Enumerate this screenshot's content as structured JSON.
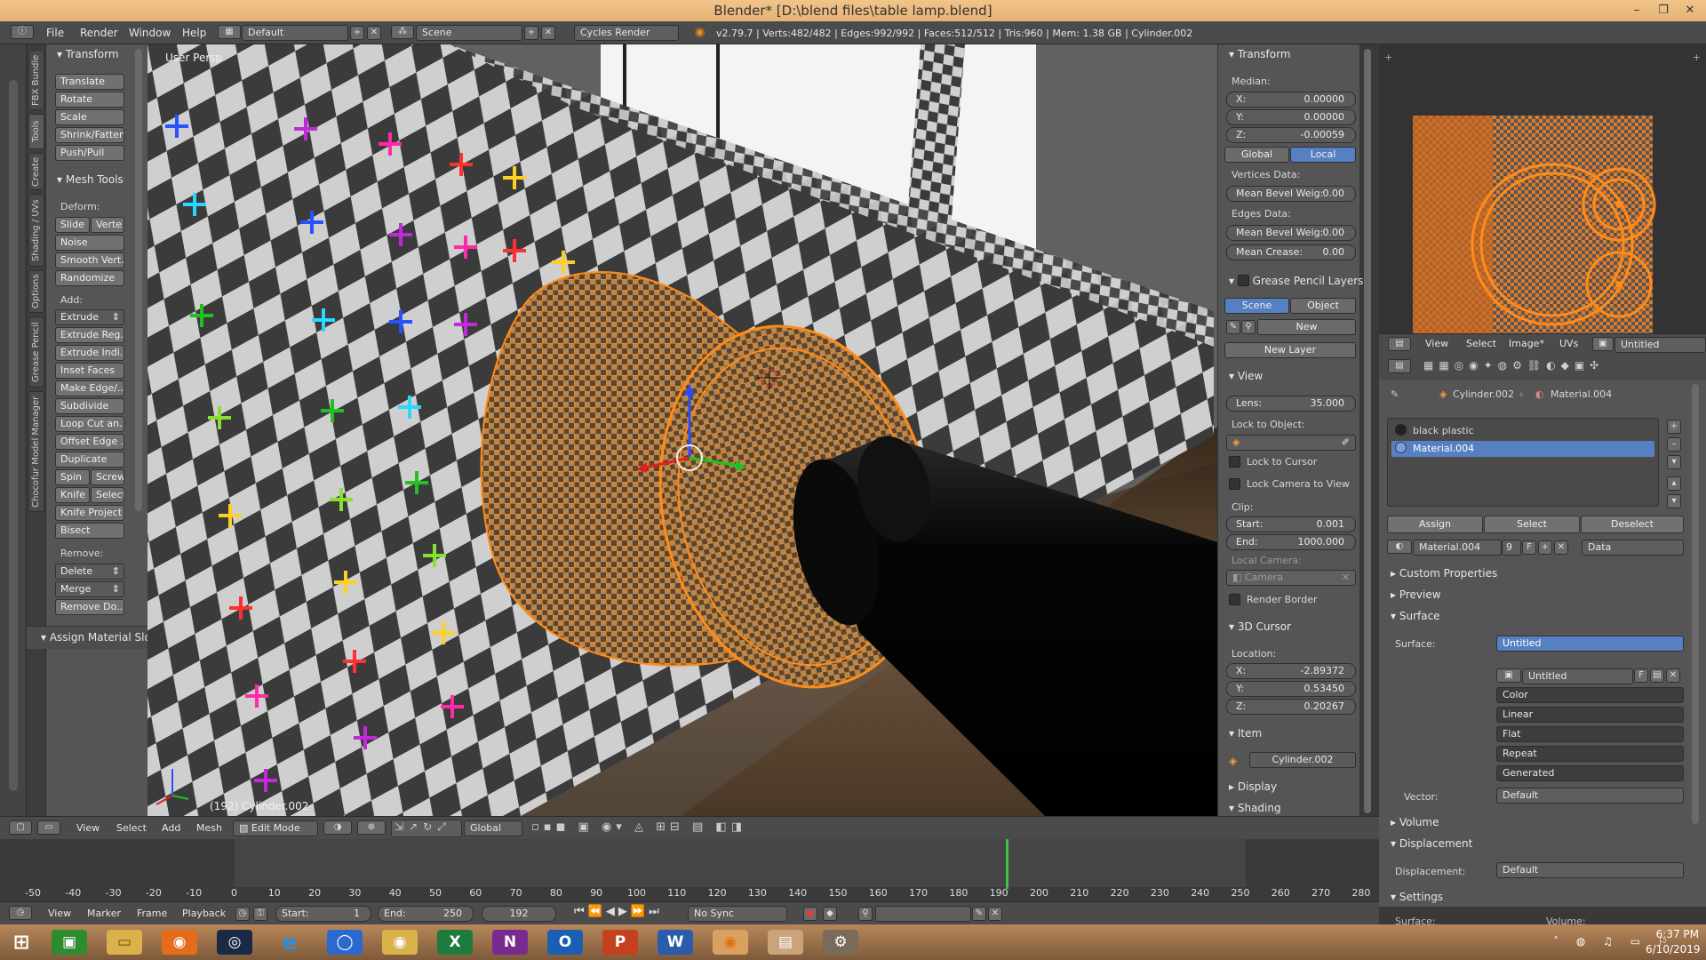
{
  "window": {
    "title": "Blender* [D:\\blend files\\table lamp.blend]",
    "controls": [
      "–",
      "❐",
      "✕"
    ]
  },
  "info_header": {
    "menus": [
      "File",
      "Render",
      "Window",
      "Help"
    ],
    "layout": "Default",
    "scene": "Scene",
    "engine": "Cycles Render",
    "stats": "v2.79.7 | Verts:482/482 | Edges:992/992 | Faces:512/512 | Tris:960 | Mem: 1.38 GB | Cylinder.002"
  },
  "tool_tabs": [
    "FBX Bundle",
    "Tools",
    "Create",
    "Shading / UVs",
    "Options",
    "Grease Pencil",
    "Chocofur Model Manager"
  ],
  "tool_shelf": {
    "transform": {
      "title": "Transform",
      "buttons": [
        "Translate",
        "Rotate",
        "Scale",
        "Shrink/Fatten",
        "Push/Pull"
      ]
    },
    "mesh_tools": {
      "title": "Mesh Tools",
      "deform_label": "Deform:",
      "slide": "Slide",
      "vertex": "Verte",
      "deform_buttons": [
        "Noise",
        "Smooth Vert.",
        "Randomize"
      ],
      "add_label": "Add:",
      "extrude": "Extrude",
      "add_buttons": [
        "Extrude Reg..",
        "Extrude Indi..",
        "Inset Faces",
        "Make Edge/..",
        "Subdivide",
        "Loop Cut an..",
        "Offset Edge ..",
        "Duplicate"
      ],
      "spin": "Spin",
      "screw": "Screw",
      "knife": "Knife",
      "select": "Select",
      "knife_project": "Knife Project",
      "bisect": "Bisect",
      "remove_label": "Remove:",
      "delete": "Delete",
      "merge": "Merge",
      "remove_doubles": "Remove Do.."
    },
    "assign_material": "Assign Material Slo"
  },
  "viewport": {
    "view_name": "User Persp",
    "object_label": "(192) Cylinder.002"
  },
  "n_panel": {
    "transform": "Transform",
    "median": "Median:",
    "x_label": "X:",
    "x": "0.00000",
    "y_label": "Y:",
    "y": "0.00000",
    "z_label": "Z:",
    "z": "-0.00059",
    "global": "Global",
    "local": "Local",
    "vertices_data": "Vertices Data:",
    "mean_bevel_v_label": "Mean Bevel Weig:",
    "mean_bevel_v": "0.00",
    "edges_data": "Edges Data:",
    "mean_bevel_e_label": "Mean Bevel Weig:",
    "mean_bevel_e": "0.00",
    "mean_crease_label": "Mean Crease:",
    "mean_crease": "0.00",
    "grease_pencil": "Grease Pencil Layers",
    "scene": "Scene",
    "object": "Object",
    "new": "New",
    "new_layer": "New Layer",
    "view": "View",
    "lens_label": "Lens:",
    "lens": "35.000",
    "lock_to_object": "Lock to Object:",
    "lock_to_cursor": "Lock to Cursor",
    "lock_camera": "Lock Camera to View",
    "clip": "Clip:",
    "start_label": "Start:",
    "clip_start": "0.001",
    "end_label": "End:",
    "clip_end": "1000.000",
    "local_camera": "Local Camera:",
    "camera": "Camera",
    "render_border": "Render Border",
    "cursor_title": "3D Cursor",
    "location": "Location:",
    "cx": "-2.89372",
    "cy": "0.53450",
    "cz": "0.20267",
    "item": "Item",
    "item_name": "Cylinder.002",
    "display": "Display",
    "shading": "Shading"
  },
  "image_editor": {
    "menus": [
      "View",
      "Select",
      "Image*",
      "UVs"
    ],
    "image_name": "Untitled"
  },
  "properties": {
    "breadcrumb_object": "Cylinder.002",
    "breadcrumb_material": "Material.004",
    "slots": [
      "black plastic",
      "Material.004"
    ],
    "assign": "Assign",
    "select": "Select",
    "deselect": "Deselect",
    "material_name": "Material.004",
    "users": "9",
    "fake": "F",
    "link": "Data",
    "custom_properties": "Custom Properties",
    "preview": "Preview",
    "surface_panel": "Surface",
    "surface_label": "Surface:",
    "surface_value": "Untitled",
    "texture_name": "Untitled",
    "texture_f": "F",
    "tex_options": [
      "Color",
      "Linear",
      "Flat",
      "Repeat",
      "Generated"
    ],
    "vector_label": "Vector:",
    "vector_value": "Default",
    "volume": "Volume",
    "displacement_panel": "Displacement",
    "displacement_label": "Displacement:",
    "displacement_value": "Default",
    "settings": "Settings",
    "surface_cut": "Surface:",
    "volume_cut": "Volume:"
  },
  "view_header": {
    "menus": [
      "View",
      "Select",
      "Add",
      "Mesh"
    ],
    "mode": "Edit Mode",
    "orientation": "Global"
  },
  "timeline": {
    "ticks": [
      "-50",
      "-40",
      "-30",
      "-20",
      "-10",
      "0",
      "10",
      "20",
      "30",
      "40",
      "50",
      "60",
      "70",
      "80",
      "90",
      "100",
      "110",
      "120",
      "130",
      "140",
      "150",
      "160",
      "170",
      "180",
      "190",
      "200",
      "210",
      "220",
      "230",
      "240",
      "250",
      "260",
      "270",
      "280"
    ],
    "current_frame": 192,
    "menus": [
      "View",
      "Marker",
      "Frame",
      "Playback"
    ],
    "start_label": "Start:",
    "start": "1",
    "end_label": "End:",
    "end": "250",
    "frame": "192",
    "sync": "No Sync"
  },
  "taskbar": {
    "time": "6:37 PM",
    "date": "6/10/2019"
  },
  "colors": {
    "selection_orange": "#ff8c1a",
    "active_blue": "#5680c2",
    "frame_line": "#3ec43e"
  }
}
